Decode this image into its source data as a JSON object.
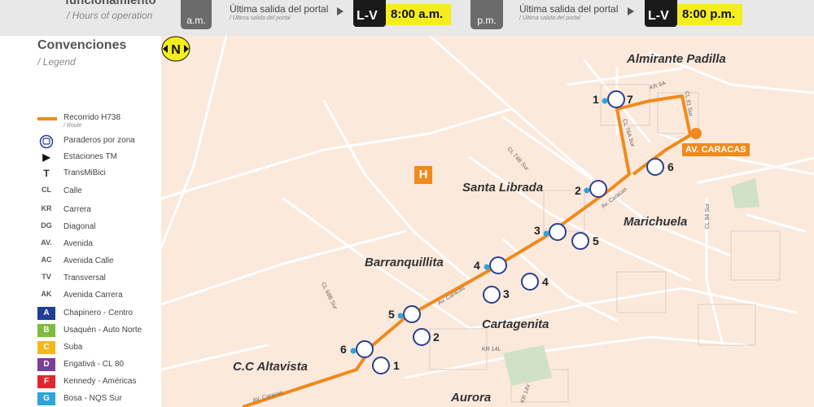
{
  "header": {
    "title": "funcionamiento",
    "subtitle": "/ Hours of operation",
    "am_label": "a.m.",
    "pm_label": "p.m.",
    "last_departure": "Última salida del portal",
    "last_departure_sub": "/ Última salida del portal",
    "am_time": "8:00 a.m.",
    "pm_time": "8:00 p.m."
  },
  "legend": {
    "title": "Convenciones",
    "subtitle": "/ Legend",
    "items": [
      {
        "symbol": "",
        "label": "Recorrido H738",
        "sub": "/ Route",
        "icon": "route-line"
      },
      {
        "symbol": "",
        "label": "Paraderos por zona",
        "icon": "bus-stop-icon"
      },
      {
        "symbol": "▶",
        "label": "Estaciones TM",
        "icon": "station-icon"
      },
      {
        "symbol": "T",
        "label": "TransMiBici",
        "icon": "bike-icon"
      },
      {
        "symbol": "CL",
        "label": "Calle"
      },
      {
        "symbol": "KR",
        "label": "Carrera"
      },
      {
        "symbol": "DG",
        "label": "Diagonal"
      },
      {
        "symbol": "AV.",
        "label": "Avenida"
      },
      {
        "symbol": "AC",
        "label": "Avenida Calle"
      },
      {
        "symbol": "TV",
        "label": "Transversal"
      },
      {
        "symbol": "AK",
        "label": "Avenida Carrera"
      }
    ],
    "zones": [
      {
        "letter": "A",
        "label": "Chapinero - Centro",
        "color": "#1f3e94"
      },
      {
        "letter": "B",
        "label": "Usaquén - Auto Norte",
        "color": "#7dbb42"
      },
      {
        "letter": "C",
        "label": "Suba",
        "color": "#f5b81c"
      },
      {
        "letter": "D",
        "label": "Engativá - CL 80",
        "color": "#7b3f97"
      },
      {
        "letter": "F",
        "label": "Kennedy - Américas",
        "color": "#e3262e"
      },
      {
        "letter": "G",
        "label": "Bosa - NQS Sur",
        "color": "#2ea3dc"
      }
    ]
  },
  "map": {
    "north_label": "N",
    "h_marker": "H",
    "route_color": "#f08a1c",
    "caracas_label": "AV. CARACAS",
    "places": [
      "Almirante Padilla",
      "Santa Librada",
      "Marichuela",
      "Barranquillita",
      "Cartagenita",
      "C.C Altavista",
      "Aurora"
    ],
    "streets": [
      "KR 9A",
      "CL 81 Sur",
      "CL 76A Sur",
      "CL 74B Sur",
      "Av. Caracas",
      "CL 84 Sur",
      "CL 68B Sur",
      "Av. Caracas",
      "KR 14L",
      "KR 14V",
      "AV. Caracas"
    ],
    "stops": [
      "1",
      "7",
      "2",
      "6",
      "3",
      "5",
      "4",
      "4",
      "3",
      "5",
      "2",
      "6",
      "1"
    ]
  }
}
